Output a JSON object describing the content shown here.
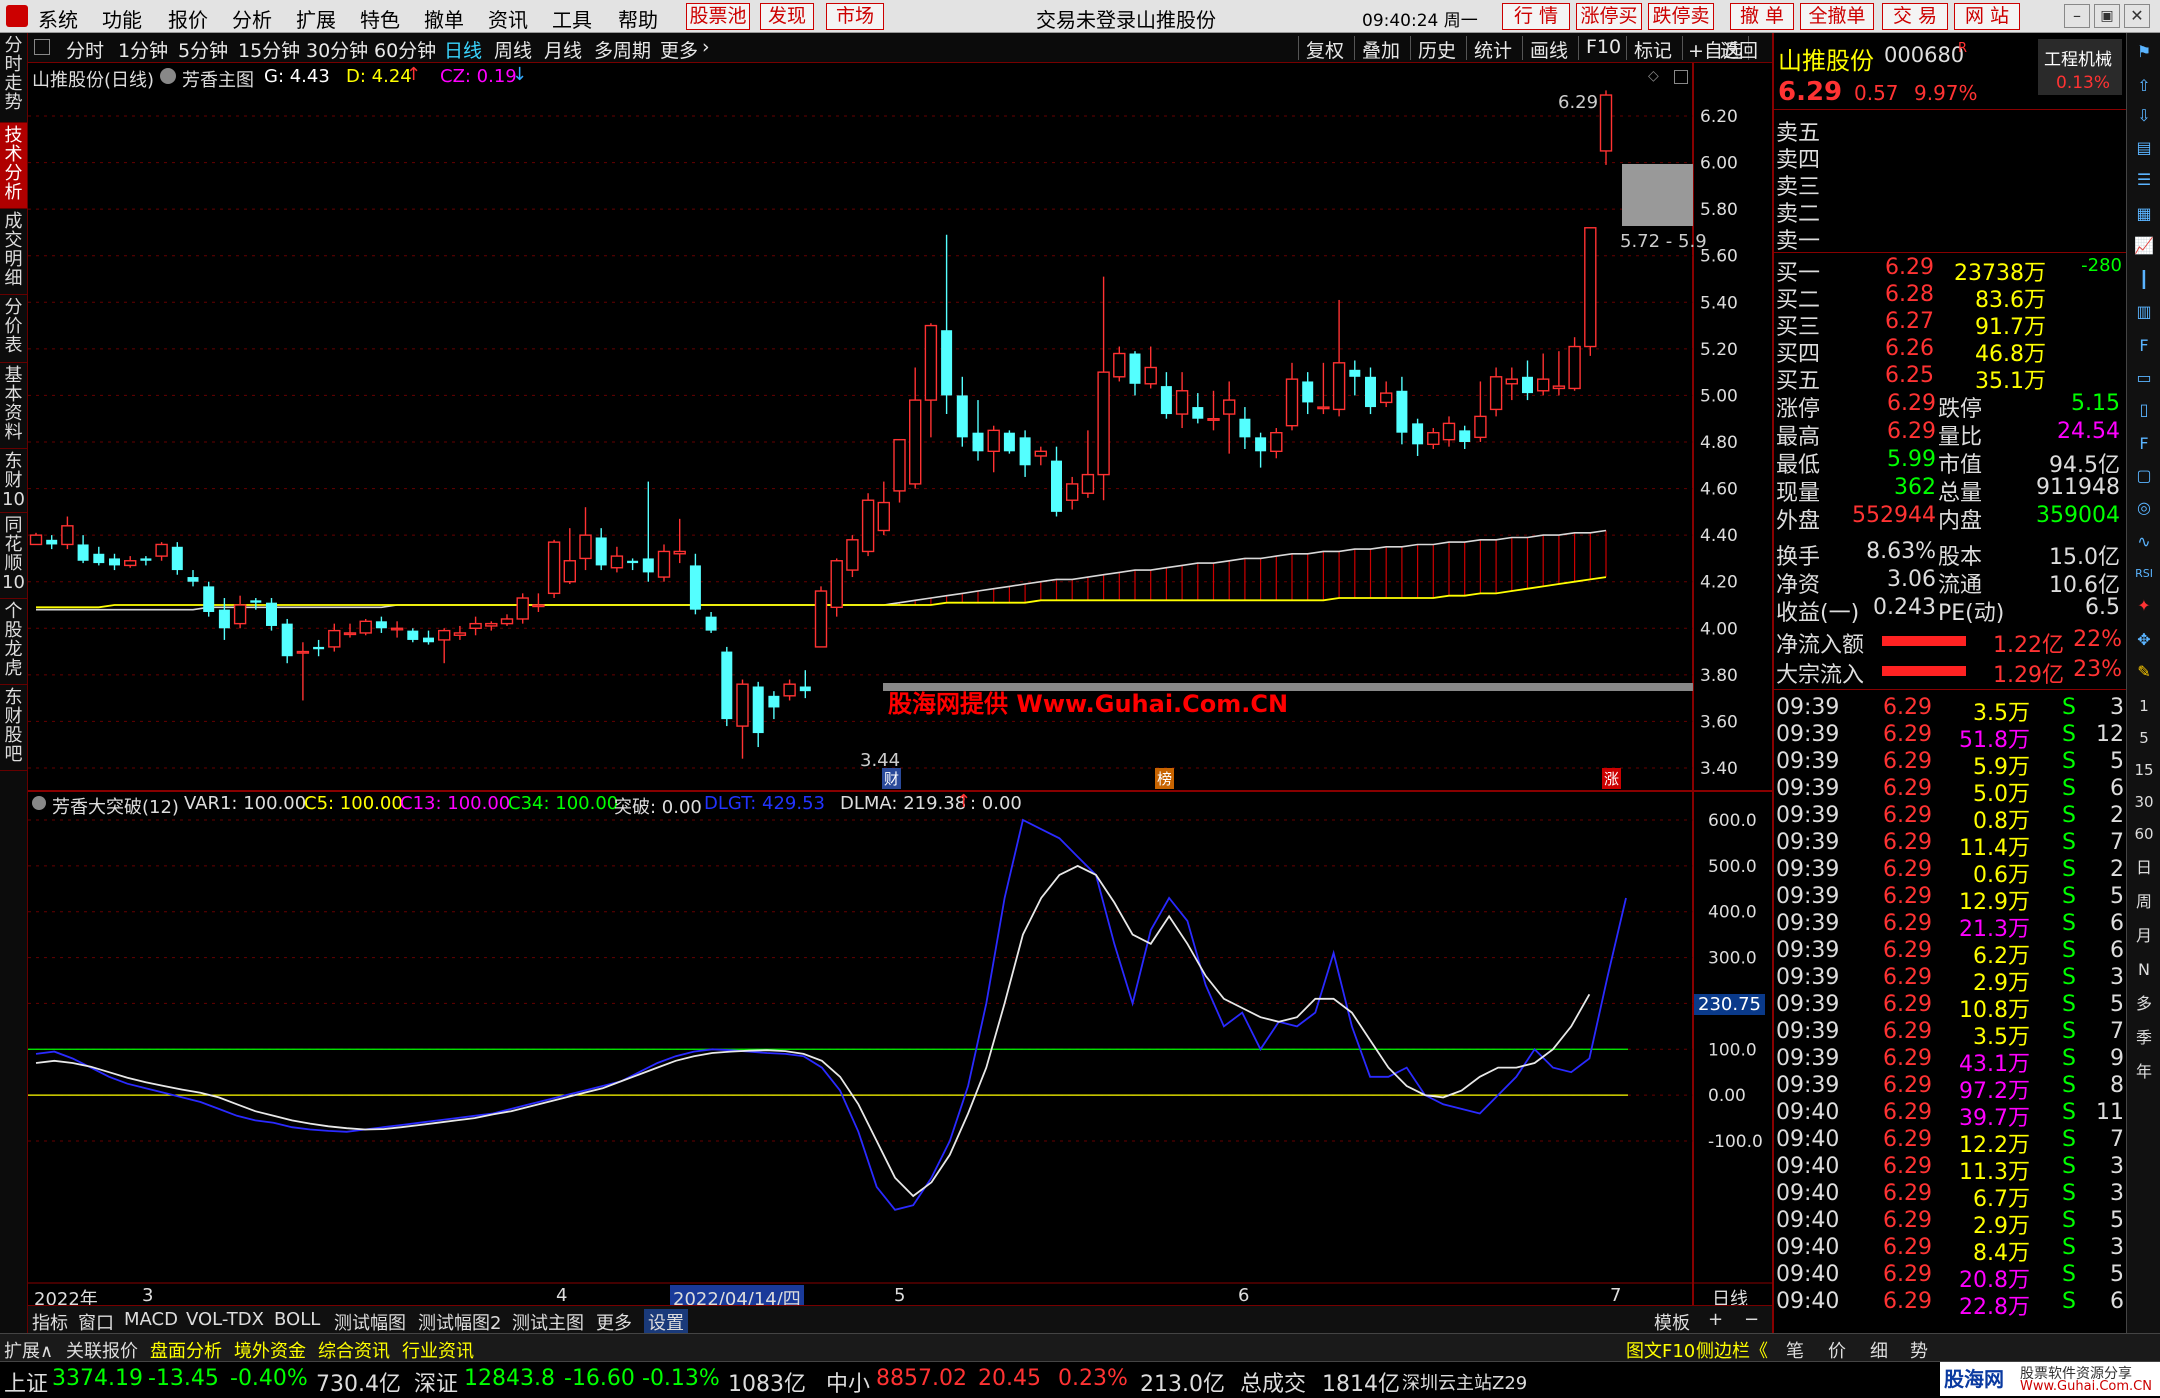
{
  "menubar": {
    "items": [
      "系统",
      "功能",
      "报价",
      "分析",
      "扩展",
      "特色",
      "撤单",
      "资讯",
      "工具",
      "帮助"
    ],
    "hot_buttons": [
      "股票池",
      "发现",
      "市场"
    ],
    "status": "交易未登录",
    "stock_name": "山推股份",
    "time": "09:40:24 周一",
    "trade_buttons": [
      "行  情",
      "涨停买",
      "跌停卖",
      "撤  单",
      "全撤单",
      "交  易",
      "网  站"
    ]
  },
  "periods": {
    "items": [
      "分时",
      "1分钟",
      "5分钟",
      "15分钟",
      "30分钟",
      "60分钟",
      "日线",
      "周线",
      "月线",
      "多周期",
      "更多"
    ],
    "active": "日线"
  },
  "toolbar": {
    "items": [
      "复权",
      "叠加",
      "历史",
      "统计",
      "画线",
      "F10",
      "标记",
      "+自选",
      "返回"
    ]
  },
  "sidebar": {
    "tabs": [
      "分时走势",
      "技术分析",
      "成交明细",
      "分价表",
      "基本资料",
      "东财10",
      "同花顺10",
      "个股龙虎",
      "东财股吧"
    ],
    "active": "技术分析"
  },
  "main_chart": {
    "title": "山推股份(日线)",
    "indicator": "芳香主图",
    "g": "G: 4.43",
    "d": "D: 4.24",
    "cz": "CZ: 0.19",
    "high_label": "6.29",
    "low_label": "3.44",
    "box_label": "5.72 - 5.9",
    "watermark": "股海网提供 Www.Guhai.Com.CN",
    "markers": [
      "财",
      "榜",
      "涨"
    ],
    "yticks": [
      "6.20",
      "6.00",
      "5.80",
      "5.60",
      "5.40",
      "5.20",
      "5.00",
      "4.80",
      "4.60",
      "4.40",
      "4.20",
      "4.00",
      "3.80",
      "3.60",
      "3.40"
    ]
  },
  "sub_chart": {
    "name": "芳香大突破(12)",
    "values": [
      "VAR1: 100.00",
      "C5: 100.00",
      "C13: 100.00",
      "C34: 100.00",
      "突破: 0.00",
      "DLGT: 429.53",
      "DLMA: 219.38",
      ": 0.00"
    ],
    "yticks": [
      "600.0",
      "500.0",
      "400.0",
      "300.0",
      "200.0",
      "100.0",
      "0.00",
      "-100.0"
    ],
    "current": "230.75"
  },
  "xaxis": {
    "labels": [
      "2022年",
      "3",
      "4",
      "2022/04/14/四",
      "5",
      "6",
      "7"
    ],
    "period": "日线"
  },
  "tabs": [
    "指标",
    "窗口",
    "MACD",
    "VOL-TDX",
    "BOLL",
    "测试幅图",
    "测试幅图2",
    "测试主图",
    "更多",
    "设置"
  ],
  "tabs_right": [
    "模板",
    "+",
    "−"
  ],
  "quote": {
    "name": "山推股份",
    "code": "000680",
    "badge": "R",
    "sector": "工程机械",
    "sector_change": "0.13%",
    "price": "6.29",
    "change": "0.57",
    "pct": "9.97%",
    "sell": [
      [
        "卖五",
        "",
        ""
      ],
      [
        "卖四",
        "",
        ""
      ],
      [
        "卖三",
        "",
        ""
      ],
      [
        "卖二",
        "",
        ""
      ],
      [
        "卖一",
        "",
        ""
      ]
    ],
    "buy": [
      [
        "买一",
        "6.29",
        "23738万",
        "-280"
      ],
      [
        "买二",
        "6.28",
        "83.6万",
        ""
      ],
      [
        "买三",
        "6.27",
        "91.7万",
        ""
      ],
      [
        "买四",
        "6.26",
        "46.8万",
        ""
      ],
      [
        "买五",
        "6.25",
        "35.1万",
        ""
      ]
    ],
    "stats": [
      [
        "涨停",
        "6.29",
        "跌停",
        "5.15"
      ],
      [
        "最高",
        "6.29",
        "量比",
        "24.54"
      ],
      [
        "最低",
        "5.99",
        "市值",
        "94.5亿"
      ],
      [
        "现量",
        "362",
        "总量",
        "911948"
      ],
      [
        "外盘",
        "552944",
        "内盘",
        "359004"
      ],
      [
        "换手",
        "8.63%",
        "股本",
        "15.0亿"
      ],
      [
        "净资",
        "3.06",
        "流通",
        "10.6亿"
      ],
      [
        "收益(一)",
        "0.243",
        "PE(动)",
        "6.5"
      ]
    ],
    "flows": [
      [
        "净流入额",
        "1.22亿",
        "22%"
      ],
      [
        "大宗流入",
        "1.29亿",
        "23%"
      ]
    ],
    "ticks": [
      [
        "09:39",
        "6.29",
        "3.5万",
        "S",
        "3"
      ],
      [
        "09:39",
        "6.29",
        "51.8万",
        "S",
        "12"
      ],
      [
        "09:39",
        "6.29",
        "5.9万",
        "S",
        "5"
      ],
      [
        "09:39",
        "6.29",
        "5.0万",
        "S",
        "6"
      ],
      [
        "09:39",
        "6.29",
        "0.8万",
        "S",
        "2"
      ],
      [
        "09:39",
        "6.29",
        "11.4万",
        "S",
        "7"
      ],
      [
        "09:39",
        "6.29",
        "0.6万",
        "S",
        "2"
      ],
      [
        "09:39",
        "6.29",
        "12.9万",
        "S",
        "5"
      ],
      [
        "09:39",
        "6.29",
        "21.3万",
        "S",
        "6"
      ],
      [
        "09:39",
        "6.29",
        "6.2万",
        "S",
        "6"
      ],
      [
        "09:39",
        "6.29",
        "2.9万",
        "S",
        "3"
      ],
      [
        "09:39",
        "6.29",
        "10.8万",
        "S",
        "5"
      ],
      [
        "09:39",
        "6.29",
        "3.5万",
        "S",
        "7"
      ],
      [
        "09:39",
        "6.29",
        "43.1万",
        "S",
        "9"
      ],
      [
        "09:39",
        "6.29",
        "97.2万",
        "S",
        "8"
      ],
      [
        "09:40",
        "6.29",
        "39.7万",
        "S",
        "11"
      ],
      [
        "09:40",
        "6.29",
        "12.2万",
        "S",
        "7"
      ],
      [
        "09:40",
        "6.29",
        "11.3万",
        "S",
        "3"
      ],
      [
        "09:40",
        "6.29",
        "6.7万",
        "S",
        "3"
      ],
      [
        "09:40",
        "6.29",
        "2.9万",
        "S",
        "5"
      ],
      [
        "09:40",
        "6.29",
        "8.4万",
        "S",
        "3"
      ],
      [
        "09:40",
        "6.29",
        "20.8万",
        "S",
        "5"
      ],
      [
        "09:40",
        "6.29",
        "22.8万",
        "S",
        "6"
      ]
    ]
  },
  "right_tools": [
    "日",
    "周",
    "月",
    "N",
    "多",
    "季",
    "年"
  ],
  "right_tools_num": [
    "1",
    "5",
    "15",
    "30",
    "60"
  ],
  "bottom": {
    "left": [
      "扩展∧",
      "关联报价",
      "盘面分析",
      "境外资金",
      "综合资讯",
      "行业资讯"
    ],
    "right": [
      "图文F10",
      "侧边栏《"
    ],
    "tabs": [
      "笔",
      "价",
      "细",
      "势"
    ]
  },
  "status": {
    "sh_label": "上证",
    "sh_value": "3374.19",
    "sh_change": "-13.45",
    "sh_pct": "-0.40%",
    "sh_amount": "730.4亿",
    "sz_label": "深证",
    "sz_value": "12843.8",
    "sz_change": "-16.60",
    "sz_pct": "-0.13%",
    "sz_amount": "1083亿",
    "zx_label": "中小",
    "zx_value": "8857.02",
    "zx_change": "20.45",
    "zx_pct": "0.23%",
    "zx_amount": "213.0亿",
    "total_label": "总成交",
    "total_amount": "1814亿",
    "server": "深圳云主站Z29",
    "logo": "股海网",
    "logo_sub": "股票软件资源分享",
    "logo_url": "Www.Guhai.Com.CN"
  },
  "chart_data": {
    "type": "candlestick",
    "candles": [
      [
        4.36,
        4.4,
        4.41,
        4.36
      ],
      [
        4.38,
        4.36,
        4.4,
        4.34
      ],
      [
        4.36,
        4.44,
        4.48,
        4.34
      ],
      [
        4.36,
        4.29,
        4.4,
        4.28
      ],
      [
        4.32,
        4.28,
        4.35,
        4.27
      ],
      [
        4.3,
        4.27,
        4.32,
        4.25
      ],
      [
        4.27,
        4.29,
        4.31,
        4.26
      ],
      [
        4.3,
        4.29,
        4.31,
        4.27
      ],
      [
        4.31,
        4.36,
        4.37,
        4.29
      ],
      [
        4.35,
        4.25,
        4.37,
        4.23
      ],
      [
        4.22,
        4.2,
        4.25,
        4.18
      ],
      [
        4.18,
        4.07,
        4.2,
        4.05
      ],
      [
        4.08,
        4.0,
        4.13,
        3.95
      ],
      [
        4.02,
        4.1,
        4.14,
        4.0
      ],
      [
        4.12,
        4.11,
        4.13,
        4.08
      ],
      [
        4.11,
        4.01,
        4.13,
        3.99
      ],
      [
        4.02,
        3.88,
        4.04,
        3.85
      ],
      [
        3.9,
        3.9,
        3.94,
        3.69
      ],
      [
        3.92,
        3.91,
        3.95,
        3.88
      ],
      [
        3.92,
        3.99,
        4.02,
        3.9
      ],
      [
        3.98,
        3.98,
        4.02,
        3.96
      ],
      [
        3.98,
        4.03,
        4.04,
        3.97
      ],
      [
        4.03,
        4.0,
        4.05,
        3.98
      ],
      [
        4.0,
        4.0,
        4.03,
        3.96
      ],
      [
        3.99,
        3.95,
        4.0,
        3.94
      ],
      [
        3.96,
        3.94,
        3.99,
        3.93
      ],
      [
        3.95,
        3.99,
        4.0,
        3.85
      ],
      [
        3.97,
        3.98,
        4.01,
        3.95
      ],
      [
        4.0,
        4.02,
        4.05,
        3.97
      ],
      [
        4.01,
        4.02,
        4.03,
        3.99
      ],
      [
        4.02,
        4.04,
        4.06,
        4.01
      ],
      [
        4.04,
        4.13,
        4.15,
        4.02
      ],
      [
        4.1,
        4.1,
        4.15,
        4.07
      ],
      [
        4.15,
        4.37,
        4.38,
        4.13
      ],
      [
        4.2,
        4.29,
        4.43,
        4.19
      ],
      [
        4.3,
        4.4,
        4.52,
        4.25
      ],
      [
        4.39,
        4.27,
        4.43,
        4.25
      ],
      [
        4.26,
        4.31,
        4.35,
        4.24
      ],
      [
        4.29,
        4.28,
        4.3,
        4.25
      ],
      [
        4.3,
        4.24,
        4.63,
        4.2
      ],
      [
        4.22,
        4.33,
        4.36,
        4.2
      ],
      [
        4.32,
        4.33,
        4.47,
        4.28
      ],
      [
        4.27,
        4.08,
        4.32,
        4.06
      ],
      [
        4.05,
        3.99,
        4.07,
        3.98
      ],
      [
        3.9,
        3.61,
        3.92,
        3.58
      ],
      [
        3.58,
        3.76,
        3.78,
        3.44
      ],
      [
        3.75,
        3.55,
        3.77,
        3.49
      ],
      [
        3.71,
        3.66,
        3.73,
        3.61
      ],
      [
        3.71,
        3.76,
        3.78,
        3.69
      ],
      [
        3.75,
        3.73,
        3.82,
        3.7
      ],
      [
        3.92,
        4.16,
        4.18,
        3.92
      ],
      [
        4.09,
        4.29,
        4.3,
        4.05
      ],
      [
        4.25,
        4.38,
        4.4,
        4.22
      ],
      [
        4.33,
        4.55,
        4.58,
        4.31
      ],
      [
        4.42,
        4.54,
        4.63,
        4.4
      ],
      [
        4.59,
        4.81,
        4.81,
        4.54
      ],
      [
        4.62,
        4.98,
        5.12,
        4.6
      ],
      [
        4.98,
        5.3,
        5.31,
        4.82
      ],
      [
        5.28,
        5.0,
        5.69,
        4.92
      ],
      [
        5.0,
        4.82,
        5.08,
        4.78
      ],
      [
        4.84,
        4.76,
        4.98,
        4.72
      ],
      [
        4.76,
        4.85,
        4.87,
        4.67
      ],
      [
        4.84,
        4.76,
        4.85,
        4.75
      ],
      [
        4.82,
        4.7,
        4.85,
        4.65
      ],
      [
        4.74,
        4.76,
        4.78,
        4.7
      ],
      [
        4.72,
        4.5,
        4.78,
        4.48
      ],
      [
        4.55,
        4.62,
        4.65,
        4.51
      ],
      [
        4.58,
        4.66,
        4.85,
        4.56
      ],
      [
        4.66,
        5.1,
        5.51,
        4.55
      ],
      [
        5.08,
        5.18,
        5.21,
        5.06
      ],
      [
        5.18,
        5.05,
        5.19,
        5.0
      ],
      [
        5.05,
        5.12,
        5.21,
        5.03
      ],
      [
        5.04,
        4.92,
        5.1,
        4.9
      ],
      [
        4.92,
        5.02,
        5.1,
        4.86
      ],
      [
        4.95,
        4.9,
        5.01,
        4.88
      ],
      [
        4.9,
        4.9,
        5.02,
        4.85
      ],
      [
        4.92,
        4.98,
        5.06,
        4.75
      ],
      [
        4.9,
        4.82,
        4.95,
        4.77
      ],
      [
        4.82,
        4.76,
        4.84,
        4.69
      ],
      [
        4.76,
        4.84,
        4.86,
        4.73
      ],
      [
        4.87,
        5.07,
        5.14,
        4.85
      ],
      [
        5.06,
        4.97,
        5.1,
        4.92
      ],
      [
        4.95,
        4.95,
        5.14,
        4.92
      ],
      [
        4.94,
        5.14,
        5.41,
        4.91
      ],
      [
        5.11,
        5.08,
        5.15,
        5.0
      ],
      [
        5.08,
        4.95,
        5.12,
        4.92
      ],
      [
        4.97,
        5.01,
        5.06,
        4.95
      ],
      [
        5.02,
        4.84,
        5.08,
        4.79
      ],
      [
        4.88,
        4.79,
        4.9,
        4.74
      ],
      [
        4.79,
        4.84,
        4.86,
        4.77
      ],
      [
        4.81,
        4.88,
        4.91,
        4.78
      ],
      [
        4.85,
        4.8,
        4.87,
        4.77
      ],
      [
        4.82,
        4.91,
        5.06,
        4.8
      ],
      [
        4.94,
        5.08,
        5.12,
        4.91
      ],
      [
        5.05,
        5.07,
        5.12,
        4.98
      ],
      [
        5.08,
        5.01,
        5.15,
        4.98
      ],
      [
        5.02,
        5.07,
        5.18,
        5.0
      ],
      [
        5.03,
        5.04,
        5.19,
        5.0
      ],
      [
        5.03,
        5.21,
        5.25,
        5.02
      ],
      [
        5.21,
        5.72,
        5.72,
        5.17
      ],
      [
        6.05,
        6.29,
        6.31,
        5.99
      ]
    ],
    "ma_yellow": [
      4.09,
      4.09,
      4.09,
      4.09,
      4.09,
      4.1,
      4.1,
      4.1,
      4.1,
      4.1,
      4.1,
      4.1,
      4.1,
      4.1,
      4.1,
      4.1,
      4.1,
      4.1,
      4.1,
      4.1,
      4.1,
      4.1,
      4.1,
      4.1,
      4.1,
      4.1,
      4.1,
      4.1,
      4.1,
      4.1,
      4.1,
      4.1,
      4.1,
      4.1,
      4.1,
      4.1,
      4.1,
      4.1,
      4.1,
      4.1,
      4.1,
      4.1,
      4.1,
      4.1,
      4.1,
      4.1,
      4.1,
      4.1,
      4.1,
      4.1,
      4.1,
      4.1,
      4.1,
      4.1,
      4.1,
      4.1,
      4.1,
      4.1,
      4.11,
      4.11,
      4.11,
      4.11,
      4.11,
      4.11,
      4.12,
      4.12,
      4.12,
      4.12,
      4.12,
      4.12,
      4.12,
      4.12,
      4.12,
      4.12,
      4.12,
      4.12,
      4.12,
      4.12,
      4.12,
      4.12,
      4.12,
      4.12,
      4.12,
      4.13,
      4.13,
      4.13,
      4.13,
      4.13,
      4.13,
      4.13,
      4.14,
      4.14,
      4.15,
      4.15,
      4.16,
      4.17,
      4.18,
      4.19,
      4.2,
      4.21,
      4.22
    ],
    "ma_upper": [
      4.08,
      4.08,
      4.08,
      4.08,
      4.08,
      4.08,
      4.08,
      4.08,
      4.08,
      4.08,
      4.08,
      4.09,
      4.09,
      4.09,
      4.09,
      4.09,
      4.09,
      4.09,
      4.09,
      4.09,
      4.09,
      4.09,
      4.09,
      4.1,
      4.1,
      4.1,
      4.1,
      4.1,
      4.1,
      4.1,
      4.1,
      4.1,
      4.1,
      4.1,
      4.1,
      4.1,
      4.1,
      4.1,
      4.1,
      4.1,
      4.1,
      4.1,
      4.1,
      4.1,
      4.1,
      4.1,
      4.1,
      4.1,
      4.1,
      4.1,
      4.1,
      4.1,
      4.1,
      4.1,
      4.1,
      4.11,
      4.12,
      4.13,
      4.14,
      4.15,
      4.16,
      4.17,
      4.18,
      4.19,
      4.2,
      4.21,
      4.21,
      4.22,
      4.23,
      4.24,
      4.25,
      4.25,
      4.26,
      4.27,
      4.28,
      4.28,
      4.29,
      4.3,
      4.3,
      4.31,
      4.32,
      4.32,
      4.33,
      4.33,
      4.34,
      4.34,
      4.35,
      4.35,
      4.36,
      4.36,
      4.37,
      4.37,
      4.38,
      4.38,
      4.39,
      4.39,
      4.4,
      4.4,
      4.41,
      4.41,
      4.42
    ],
    "dlgt": [
      90,
      95,
      80,
      60,
      40,
      25,
      15,
      5,
      -5,
      -15,
      -30,
      -45,
      -55,
      -60,
      -70,
      -75,
      -78,
      -80,
      -75,
      -70,
      -65,
      -60,
      -55,
      -50,
      -45,
      -40,
      -30,
      -20,
      -10,
      0,
      10,
      20,
      30,
      50,
      70,
      85,
      95,
      100,
      98,
      95,
      92,
      90,
      85,
      60,
      10,
      -80,
      -200,
      -250,
      -240,
      -180,
      -100,
      20,
      200,
      430,
      600,
      580,
      560,
      520,
      480,
      330,
      200,
      360,
      430,
      380,
      240,
      150,
      180,
      100,
      160,
      150,
      180,
      310,
      150,
      40,
      40,
      60,
      0,
      -20,
      -30,
      -40,
      0,
      40,
      100,
      60,
      50,
      80,
      260,
      430
    ],
    "dlma": [
      70,
      75,
      70,
      62,
      50,
      38,
      28,
      20,
      12,
      5,
      -5,
      -20,
      -35,
      -45,
      -55,
      -62,
      -68,
      -72,
      -75,
      -74,
      -70,
      -65,
      -60,
      -55,
      -50,
      -42,
      -35,
      -25,
      -15,
      -5,
      5,
      15,
      30,
      45,
      60,
      75,
      85,
      92,
      95,
      97,
      98,
      96,
      90,
      75,
      40,
      -20,
      -100,
      -180,
      -220,
      -190,
      -130,
      -40,
      60,
      200,
      350,
      430,
      480,
      500,
      480,
      420,
      350,
      330,
      390,
      330,
      260,
      210,
      190,
      170,
      160,
      170,
      210,
      210,
      180,
      120,
      60,
      20,
      0,
      -5,
      10,
      40,
      60,
      60,
      70,
      100,
      150,
      220
    ]
  }
}
